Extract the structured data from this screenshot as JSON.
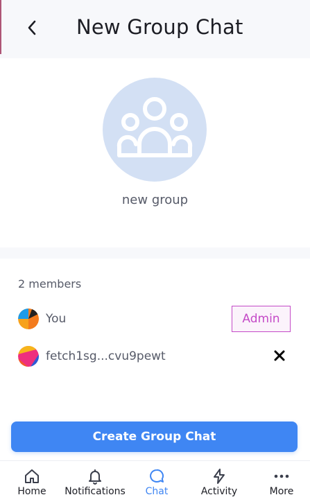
{
  "header": {
    "title": "New Group Chat"
  },
  "group": {
    "name": "new group"
  },
  "members": {
    "count_label": "2 members",
    "items": [
      {
        "label": "You",
        "badge": "Admin"
      },
      {
        "label": "fetch1sg...cvu9pewt"
      }
    ]
  },
  "actions": {
    "create_label": "Create Group Chat"
  },
  "nav": {
    "items": [
      {
        "label": "Home",
        "icon": "home-icon"
      },
      {
        "label": "Notifications",
        "icon": "bell-icon"
      },
      {
        "label": "Chat",
        "icon": "chat-icon",
        "active": true
      },
      {
        "label": "Activity",
        "icon": "lightning-icon"
      },
      {
        "label": "More",
        "icon": "more-icon"
      }
    ]
  },
  "colors": {
    "accent": "#3f86f3",
    "admin": "#c44ac7",
    "avatar_bg": "#d3e0f4"
  }
}
